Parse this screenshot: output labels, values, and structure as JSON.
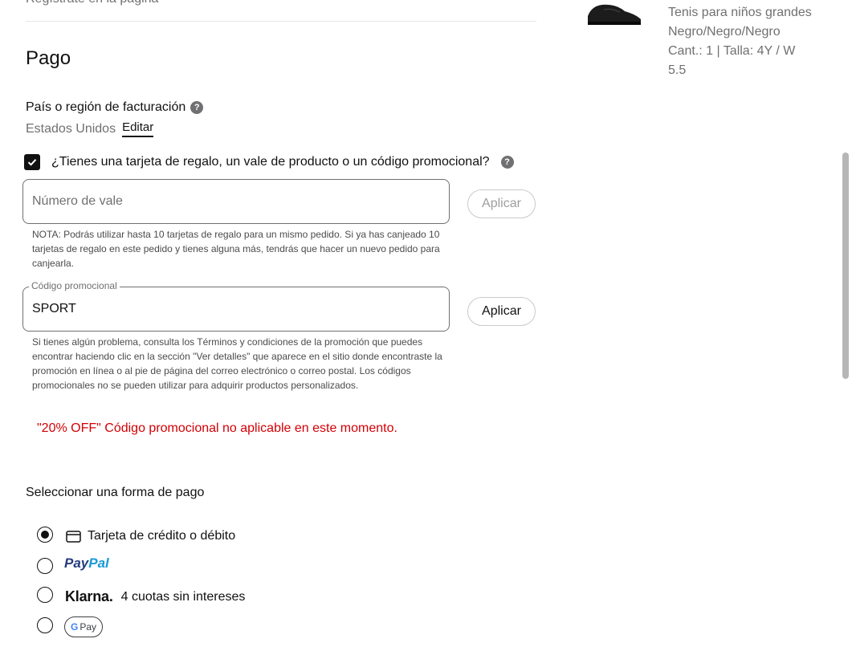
{
  "header_cut_text": "Regístrate en la página",
  "payment": {
    "title": "Pago",
    "billing_label": "País o región de facturación",
    "billing_country": "Estados Unidos",
    "edit_label": "Editar",
    "gift_question": "¿Tienes una tarjeta de regalo, un vale de producto o un código promocional?",
    "gift_checked": true,
    "voucher_placeholder": "Número de vale",
    "voucher_value": "",
    "apply_label": "Aplicar",
    "voucher_note": "NOTA: Podrás utilizar hasta 10 tarjetas de regalo para un mismo pedido. Si ya has canjeado 10 tarjetas de regalo en este pedido y tienes alguna más, tendrás que hacer un nuevo pedido para canjearla.",
    "promo_label": "Código promocional",
    "promo_value": "SPORT",
    "promo_apply_label": "Aplicar",
    "promo_note": "Si tienes algún problema, consulta los Términos y condiciones de la promoción que puedes encontrar haciendo clic en la sección \"Ver detalles\" que aparece en el sitio donde encontraste la promoción en línea o al pie de página del correo electrónico o correo postal. Los códigos promocionales no se pueden utilizar para adquirir productos personalizados.",
    "promo_error": "\"20% OFF\" Código promocional no aplicable en este momento.",
    "method_heading": "Seleccionar una forma de pago",
    "methods": [
      {
        "label": "Tarjeta de crédito o débito",
        "selected": true
      },
      {
        "label_a": "Pay",
        "label_b": "Pal",
        "selected": false
      },
      {
        "logo": "Klarna.",
        "label": "4 cuotas sin intereses",
        "selected": false
      },
      {
        "label_g": "G",
        "label": "Pay",
        "selected": false
      }
    ]
  },
  "product": {
    "name": "Tenis para niños grandes",
    "color": "Negro/Negro/Negro",
    "qty_size": "Cant.: 1   |  Talla: 4Y / W",
    "size_cont": "5.5"
  },
  "colors": {
    "error": "#d30005",
    "paypal_dark": "#253b80",
    "paypal_light": "#179bd7"
  }
}
